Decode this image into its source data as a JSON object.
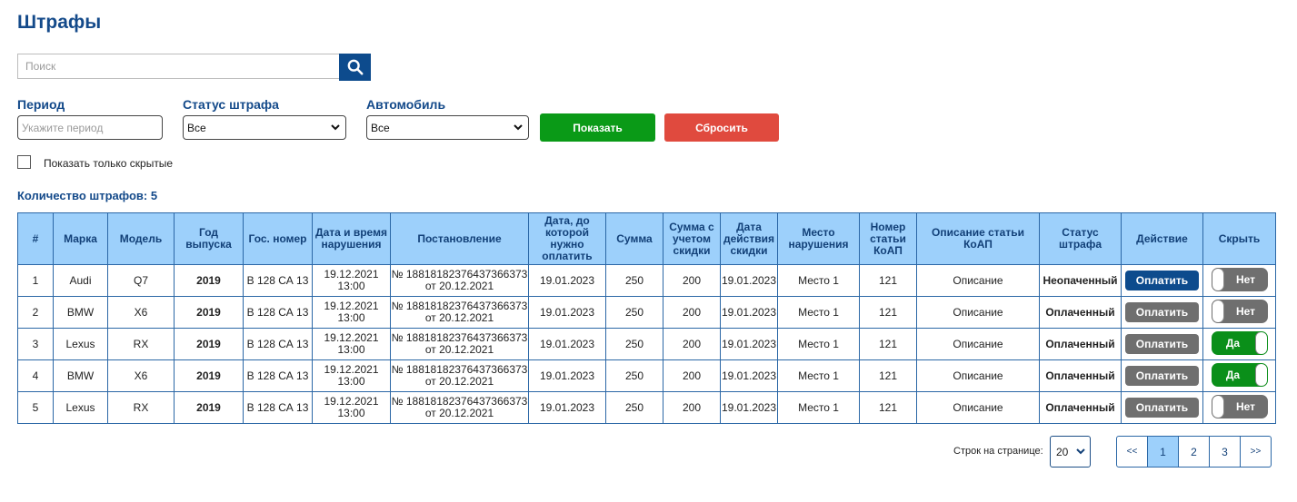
{
  "page": {
    "title": "Штрафы"
  },
  "search": {
    "placeholder": "Поиск",
    "value": ""
  },
  "filters": {
    "period": {
      "label": "Период",
      "placeholder": "Укажите период"
    },
    "status": {
      "label": "Статус штрафа",
      "selected": "Все"
    },
    "car": {
      "label": "Автомобиль",
      "selected": "Все"
    },
    "show_button": "Показать",
    "reset_button": "Сбросить",
    "hidden_only": {
      "label": "Показать только скрытые",
      "checked": false
    }
  },
  "count_label": "Количество штрафов: 5",
  "table": {
    "headers": [
      "#",
      "Марка",
      "Модель",
      "Год выпуска",
      "Гос. номер",
      "Дата и время нарушения",
      "Постановление",
      "Дата, до которой нужно оплатить",
      "Сумма",
      "Сумма с учетом скидки",
      "Дата действия скидки",
      "Место нарушения",
      "Номер статьи КоАП",
      "Описание статьи КоАП",
      "Статус штрафа",
      "Действие",
      "Скрыть"
    ],
    "rows": [
      {
        "num": "1",
        "brand": "Audi",
        "model": "Q7",
        "year": "2019",
        "plate": "В 128 СА 13",
        "datetime_date": "19.12.2021",
        "datetime_time": "13:00",
        "decree_num": "№ 18818182376437366373",
        "decree_date": "от 20.12.2021",
        "pay_until": "19.01.2023",
        "sum": "250",
        "sum_discount": "200",
        "discount_until": "19.01.2023",
        "place": "Место 1",
        "article": "121",
        "description": "Описание",
        "status": "Неопаченный",
        "status_paid": false,
        "action": "Оплатить",
        "action_active": true,
        "hide_label": "Нет",
        "hidden": false
      },
      {
        "num": "2",
        "brand": "BMW",
        "model": "X6",
        "year": "2019",
        "plate": "В 128 СА 13",
        "datetime_date": "19.12.2021",
        "datetime_time": "13:00",
        "decree_num": "№ 18818182376437366373",
        "decree_date": "от 20.12.2021",
        "pay_until": "19.01.2023",
        "sum": "250",
        "sum_discount": "200",
        "discount_until": "19.01.2023",
        "place": "Место 1",
        "article": "121",
        "description": "Описание",
        "status": "Оплаченный",
        "status_paid": true,
        "action": "Оплатить",
        "action_active": false,
        "hide_label": "Нет",
        "hidden": false
      },
      {
        "num": "3",
        "brand": "Lexus",
        "model": "RX",
        "year": "2019",
        "plate": "В 128 СА 13",
        "datetime_date": "19.12.2021",
        "datetime_time": "13:00",
        "decree_num": "№ 18818182376437366373",
        "decree_date": "от 20.12.2021",
        "pay_until": "19.01.2023",
        "sum": "250",
        "sum_discount": "200",
        "discount_until": "19.01.2023",
        "place": "Место 1",
        "article": "121",
        "description": "Описание",
        "status": "Оплаченный",
        "status_paid": true,
        "action": "Оплатить",
        "action_active": false,
        "hide_label": "Да",
        "hidden": true
      },
      {
        "num": "4",
        "brand": "BMW",
        "model": "X6",
        "year": "2019",
        "plate": "В 128 СА 13",
        "datetime_date": "19.12.2021",
        "datetime_time": "13:00",
        "decree_num": "№ 18818182376437366373",
        "decree_date": "от 20.12.2021",
        "pay_until": "19.01.2023",
        "sum": "250",
        "sum_discount": "200",
        "discount_until": "19.01.2023",
        "place": "Место 1",
        "article": "121",
        "description": "Описание",
        "status": "Оплаченный",
        "status_paid": true,
        "action": "Оплатить",
        "action_active": false,
        "hide_label": "Да",
        "hidden": true
      },
      {
        "num": "5",
        "brand": "Lexus",
        "model": "RX",
        "year": "2019",
        "plate": "В 128 СА 13",
        "datetime_date": "19.12.2021",
        "datetime_time": "13:00",
        "decree_num": "№ 18818182376437366373",
        "decree_date": "от 20.12.2021",
        "pay_until": "19.01.2023",
        "sum": "250",
        "sum_discount": "200",
        "discount_until": "19.01.2023",
        "place": "Место 1",
        "article": "121",
        "description": "Описание",
        "status": "Оплаченный",
        "status_paid": true,
        "action": "Оплатить",
        "action_active": false,
        "hide_label": "Нет",
        "hidden": false
      }
    ]
  },
  "pagination": {
    "rows_per_page_label": "Строк на странице:",
    "rows_per_page": "20",
    "first": "<<",
    "pages": [
      "1",
      "2",
      "3"
    ],
    "current_page": "1",
    "last": ">>"
  },
  "colors": {
    "primary": "#0d4b8d",
    "header_bg": "#9dd0fb",
    "show_button": "#0a9a17",
    "reset_button": "#e04a3e",
    "status_unpaid": "#c4141c",
    "status_paid": "#13891a",
    "toggle_on": "#0a8f19",
    "toggle_off": "#6f6f6f"
  },
  "icons": {
    "search": "search-icon",
    "dropdown": "chevron-down-icon"
  }
}
